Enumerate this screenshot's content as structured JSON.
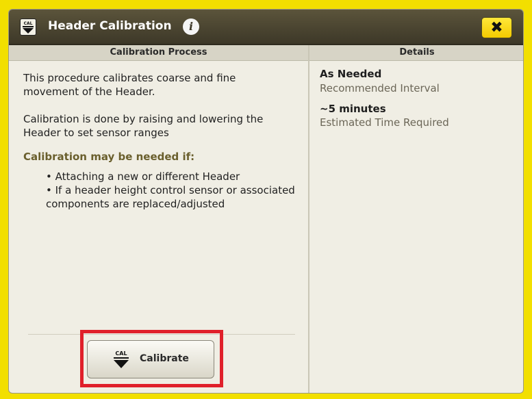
{
  "dialog": {
    "title": "Header Calibration",
    "title_icon": "cal-icon",
    "info_icon": "info-icon",
    "close_icon": "close-icon",
    "close_label": "✖"
  },
  "left": {
    "header": "Calibration Process",
    "p1_line1": "This procedure calibrates coarse and fine",
    "p1_line2": "movement of the Header.",
    "p2_line1": "Calibration is done by raising and lowering the",
    "p2_line2": "Header to set sensor ranges",
    "subhead": "Calibration may be needed if:",
    "bullets": [
      "• Attaching a new or different Header",
      "• If a header height control sensor or associated",
      "components are replaced/adjusted"
    ],
    "calibrate_button": "Calibrate",
    "cal_icon_label": "CAL"
  },
  "right": {
    "header": "Details",
    "item1_value": "As Needed",
    "item1_caption": "Recommended Interval",
    "item2_value": "~5 minutes",
    "item2_caption": "Estimated Time Required"
  },
  "colors": {
    "background": "#f2df00",
    "titlebar": "#4a4430",
    "accent_red": "#e0202a",
    "close_yellow": "#f7d800"
  }
}
